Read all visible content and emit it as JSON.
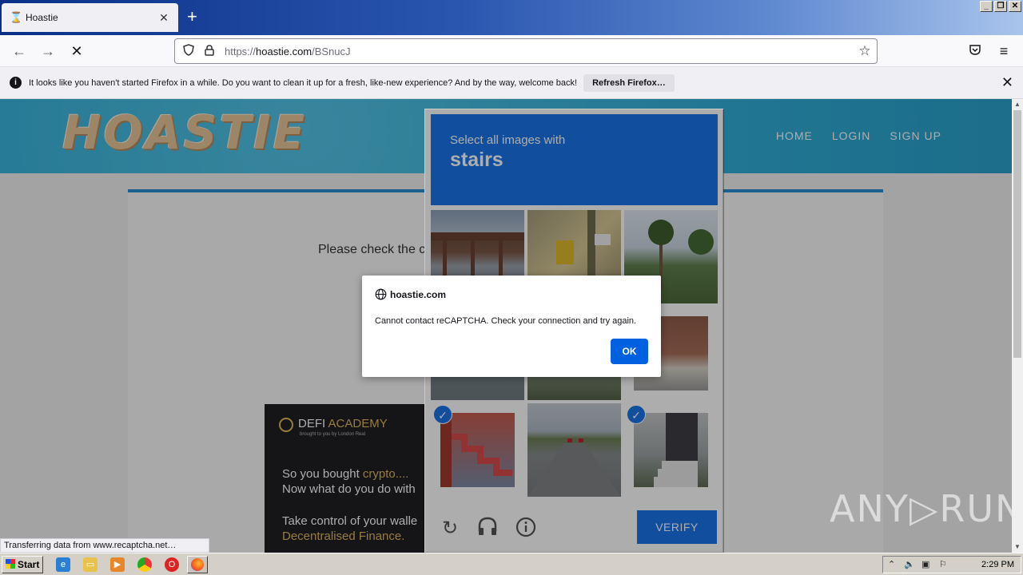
{
  "browser": {
    "tab_title": "Hoastie",
    "tab_favicon": "hourglass-icon",
    "url_prefix": "https://",
    "url_host": "hoastie.com",
    "url_path": "/BSnucJ"
  },
  "notification": {
    "message": "It looks like you haven't started Firefox in a while. Do you want to clean it up for a fresh, like-new experience? And by the way, welcome back!",
    "button": "Refresh Firefox…"
  },
  "site": {
    "logo": "HOASTIE",
    "nav": [
      "HOME",
      "LOGIN",
      "SIGN UP"
    ],
    "please_check": "Please check the c"
  },
  "ad": {
    "brand_a": "DEFI ",
    "brand_b": "ACADEMY",
    "sub": "brought to you by London Real",
    "line1_a": "So you bought ",
    "line1_b": "crypto....",
    "line2": "Now what do you do with",
    "line3": "Take control of your walle",
    "line4": "Decentralised Finance."
  },
  "captcha": {
    "instruction": "Select all images with",
    "keyword": "stairs",
    "verify": "VERIFY",
    "tiles": [
      {
        "scene": "elevated-railway",
        "selected": false
      },
      {
        "scene": "traffic-light",
        "selected": false
      },
      {
        "scene": "palm-trees",
        "selected": false
      },
      {
        "scene": "roof",
        "selected": false
      },
      {
        "scene": "road",
        "selected": false
      },
      {
        "scene": "house-porch",
        "selected": false
      },
      {
        "scene": "red-stairs",
        "selected": true
      },
      {
        "scene": "street",
        "selected": false
      },
      {
        "scene": "porch-stairs",
        "selected": true
      }
    ]
  },
  "dialog": {
    "title": "hoastie.com",
    "message": "Cannot contact reCAPTCHA. Check your connection and try again.",
    "ok": "OK"
  },
  "status_text": "Transferring data from www.recaptcha.net…",
  "watermark": "ANY▷RUN",
  "taskbar": {
    "start": "Start",
    "clock": "2:29 PM"
  },
  "colors": {
    "captcha_blue": "#1a73e8",
    "dialog_button": "#0061e0",
    "banner": "#31afd9"
  }
}
